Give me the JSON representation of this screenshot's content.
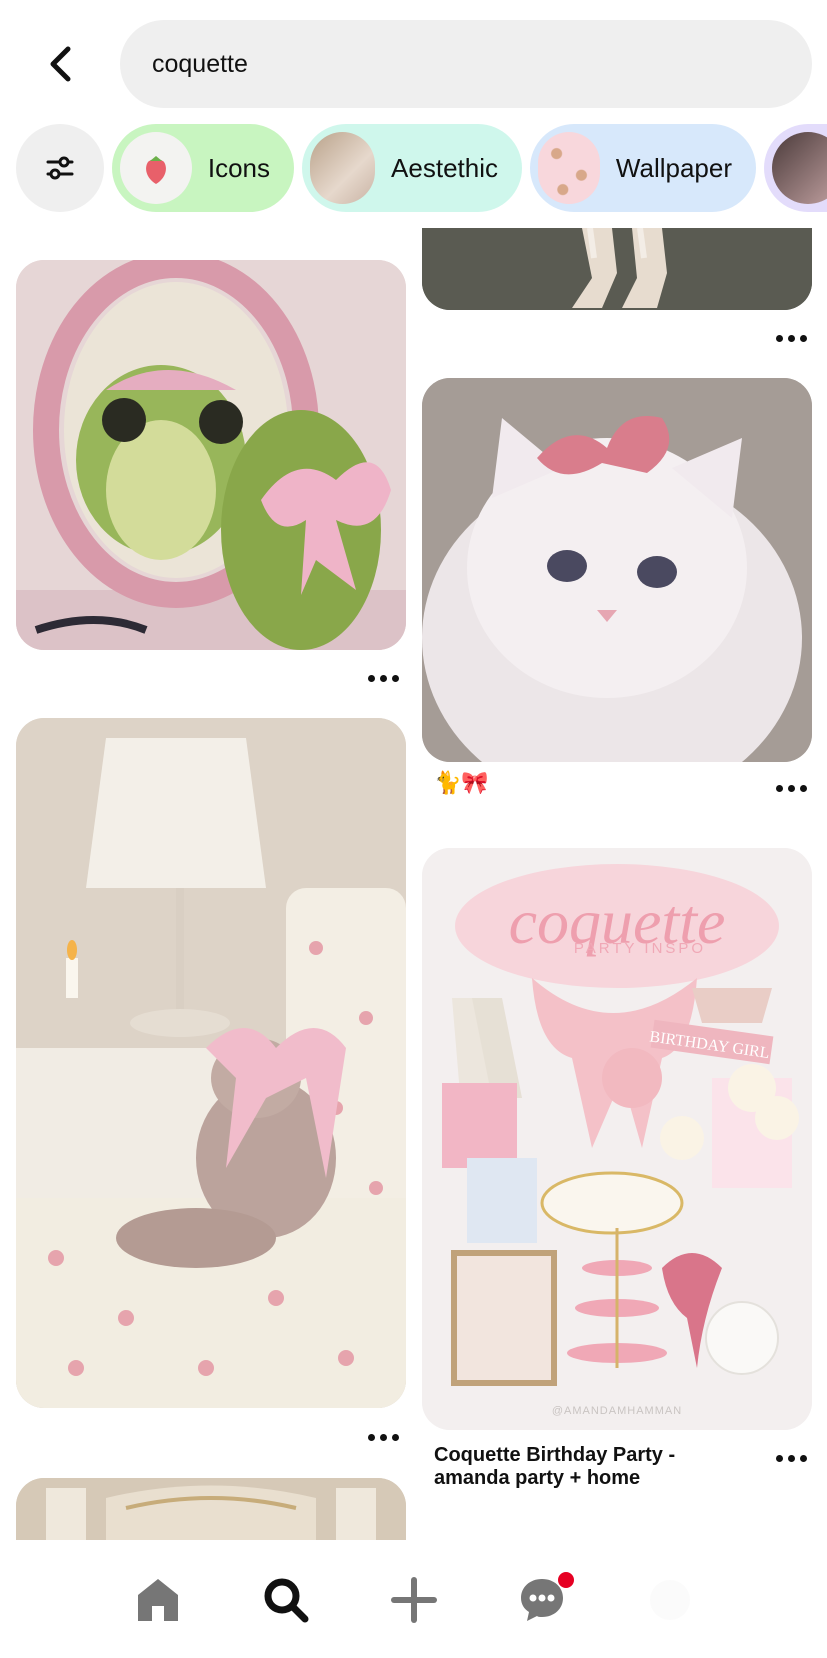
{
  "search": {
    "query": "coquette"
  },
  "chips": [
    {
      "label": "Icons",
      "color": "#c8f5c0",
      "thumb": "strawberry"
    },
    {
      "label": "Aestethic",
      "color": "#cff7ec",
      "thumb": "room"
    },
    {
      "label": "Wallpaper",
      "color": "#d7e8fb",
      "thumb": "bears"
    }
  ],
  "pins": {
    "right_top_caption": "",
    "cat_caption": "🐈🎀",
    "party": {
      "title": "Coquette Birthday Party - amanda party + home",
      "graphic_title": "coquette",
      "graphic_subtitle": "PARTY INSPO",
      "graphic_banner": "BIRTHDAY GIRL",
      "graphic_credit": "@AMANDAMHAMMAN"
    }
  },
  "nav": {
    "items": [
      "home-icon",
      "search-icon",
      "plus-icon",
      "chat-icon",
      "profile-icon"
    ],
    "active": "search-icon"
  },
  "colors": {
    "accent": "#e60023",
    "chip_gray": "#efefef"
  }
}
